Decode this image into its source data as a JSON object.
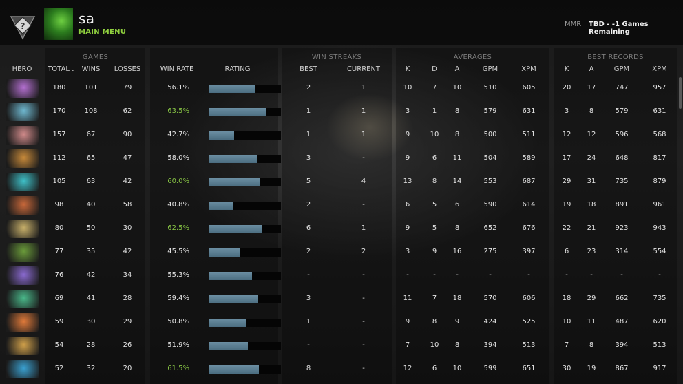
{
  "header": {
    "player_name": "sa",
    "main_menu_label": "MAIN MENU",
    "mmr_label": "MMR",
    "mmr_value": "TBD - -1 Games Remaining",
    "rank_badge_text": "?"
  },
  "groups": {
    "games": "GAMES",
    "win_streaks": "WIN STREAKS",
    "averages": "AVERAGES",
    "best_records": "BEST RECORDS"
  },
  "columns": {
    "hero": "HERO",
    "total": "TOTAL",
    "wins": "WINS",
    "losses": "LOSSES",
    "win_rate": "WIN RATE",
    "rating": "RATING",
    "best": "BEST",
    "current": "CURRENT",
    "avg_k": "K",
    "avg_d": "D",
    "avg_a": "A",
    "avg_gpm": "GPM",
    "avg_xpm": "XPM",
    "best_k": "K",
    "best_a": "A",
    "best_gpm": "GPM",
    "best_xpm": "XPM"
  },
  "colors": {
    "win_rate_highlight": "#86c244",
    "rating_bar": "#5a7d91",
    "main_menu": "#8fcf3e"
  },
  "rows": [
    {
      "portrait": "hero-portrait-1",
      "color": "#b36fd0",
      "total": "180",
      "wins": "101",
      "losses": "79",
      "win_rate": "56.1%",
      "highlight": false,
      "rating": 0.63,
      "best_streak": "2",
      "current_streak": "1",
      "k": "10",
      "d": "7",
      "a": "10",
      "gpm": "510",
      "xpm": "605",
      "best_k": "20",
      "best_a": "17",
      "best_gpm": "747",
      "best_xpm": "957"
    },
    {
      "portrait": "hero-portrait-2",
      "color": "#6fb8d0",
      "total": "170",
      "wins": "108",
      "losses": "62",
      "win_rate": "63.5%",
      "highlight": true,
      "rating": 0.8,
      "best_streak": "1",
      "current_streak": "1",
      "k": "3",
      "d": "1",
      "a": "8",
      "gpm": "579",
      "xpm": "631",
      "best_k": "3",
      "best_a": "8",
      "best_gpm": "579",
      "best_xpm": "631"
    },
    {
      "portrait": "hero-portrait-3",
      "color": "#d08a8a",
      "total": "157",
      "wins": "67",
      "losses": "90",
      "win_rate": "42.7%",
      "highlight": false,
      "rating": 0.35,
      "best_streak": "1",
      "current_streak": "1",
      "k": "9",
      "d": "10",
      "a": "8",
      "gpm": "500",
      "xpm": "511",
      "best_k": "12",
      "best_a": "12",
      "best_gpm": "596",
      "best_xpm": "568"
    },
    {
      "portrait": "hero-portrait-4",
      "color": "#c88a3a",
      "total": "112",
      "wins": "65",
      "losses": "47",
      "win_rate": "58.0%",
      "highlight": false,
      "rating": 0.66,
      "best_streak": "3",
      "current_streak": "-",
      "k": "9",
      "d": "6",
      "a": "11",
      "gpm": "504",
      "xpm": "589",
      "best_k": "17",
      "best_a": "24",
      "best_gpm": "648",
      "best_xpm": "817"
    },
    {
      "portrait": "hero-portrait-5",
      "color": "#3fc0c8",
      "total": "105",
      "wins": "63",
      "losses": "42",
      "win_rate": "60.0%",
      "highlight": true,
      "rating": 0.7,
      "best_streak": "5",
      "current_streak": "4",
      "k": "13",
      "d": "8",
      "a": "14",
      "gpm": "553",
      "xpm": "687",
      "best_k": "29",
      "best_a": "31",
      "best_gpm": "735",
      "best_xpm": "879"
    },
    {
      "portrait": "hero-portrait-6",
      "color": "#c8683a",
      "total": "98",
      "wins": "40",
      "losses": "58",
      "win_rate": "40.8%",
      "highlight": false,
      "rating": 0.33,
      "best_streak": "2",
      "current_streak": "-",
      "k": "6",
      "d": "5",
      "a": "6",
      "gpm": "590",
      "xpm": "614",
      "best_k": "19",
      "best_a": "18",
      "best_gpm": "891",
      "best_xpm": "961"
    },
    {
      "portrait": "hero-portrait-7",
      "color": "#c8b06a",
      "total": "80",
      "wins": "50",
      "losses": "30",
      "win_rate": "62.5%",
      "highlight": true,
      "rating": 0.73,
      "best_streak": "6",
      "current_streak": "1",
      "k": "9",
      "d": "5",
      "a": "8",
      "gpm": "652",
      "xpm": "676",
      "best_k": "22",
      "best_a": "21",
      "best_gpm": "923",
      "best_xpm": "943"
    },
    {
      "portrait": "hero-portrait-8",
      "color": "#6a9a3a",
      "total": "77",
      "wins": "35",
      "losses": "42",
      "win_rate": "45.5%",
      "highlight": false,
      "rating": 0.43,
      "best_streak": "2",
      "current_streak": "2",
      "k": "3",
      "d": "9",
      "a": "16",
      "gpm": "275",
      "xpm": "397",
      "best_k": "6",
      "best_a": "23",
      "best_gpm": "314",
      "best_xpm": "554"
    },
    {
      "portrait": "hero-portrait-9",
      "color": "#8a6ad0",
      "total": "76",
      "wins": "42",
      "losses": "34",
      "win_rate": "55.3%",
      "highlight": false,
      "rating": 0.6,
      "best_streak": "-",
      "current_streak": "-",
      "k": "-",
      "d": "-",
      "a": "-",
      "gpm": "-",
      "xpm": "-",
      "best_k": "-",
      "best_a": "-",
      "best_gpm": "-",
      "best_xpm": "-"
    },
    {
      "portrait": "hero-portrait-10",
      "color": "#4ab88a",
      "total": "69",
      "wins": "41",
      "losses": "28",
      "win_rate": "59.4%",
      "highlight": false,
      "rating": 0.67,
      "best_streak": "3",
      "current_streak": "-",
      "k": "11",
      "d": "7",
      "a": "18",
      "gpm": "570",
      "xpm": "606",
      "best_k": "18",
      "best_a": "29",
      "best_gpm": "662",
      "best_xpm": "735"
    },
    {
      "portrait": "hero-portrait-11",
      "color": "#e07a3a",
      "total": "59",
      "wins": "30",
      "losses": "29",
      "win_rate": "50.8%",
      "highlight": false,
      "rating": 0.52,
      "best_streak": "1",
      "current_streak": "-",
      "k": "9",
      "d": "8",
      "a": "9",
      "gpm": "424",
      "xpm": "525",
      "best_k": "10",
      "best_a": "11",
      "best_gpm": "487",
      "best_xpm": "620"
    },
    {
      "portrait": "hero-portrait-12",
      "color": "#d0a04a",
      "total": "54",
      "wins": "28",
      "losses": "26",
      "win_rate": "51.9%",
      "highlight": false,
      "rating": 0.54,
      "best_streak": "-",
      "current_streak": "-",
      "k": "7",
      "d": "10",
      "a": "8",
      "gpm": "394",
      "xpm": "513",
      "best_k": "7",
      "best_a": "8",
      "best_gpm": "394",
      "best_xpm": "513"
    },
    {
      "portrait": "hero-portrait-13",
      "color": "#3aa0d0",
      "total": "52",
      "wins": "32",
      "losses": "20",
      "win_rate": "61.5%",
      "highlight": true,
      "rating": 0.69,
      "best_streak": "8",
      "current_streak": "-",
      "k": "12",
      "d": "6",
      "a": "10",
      "gpm": "599",
      "xpm": "651",
      "best_k": "30",
      "best_a": "19",
      "best_gpm": "867",
      "best_xpm": "917"
    }
  ]
}
